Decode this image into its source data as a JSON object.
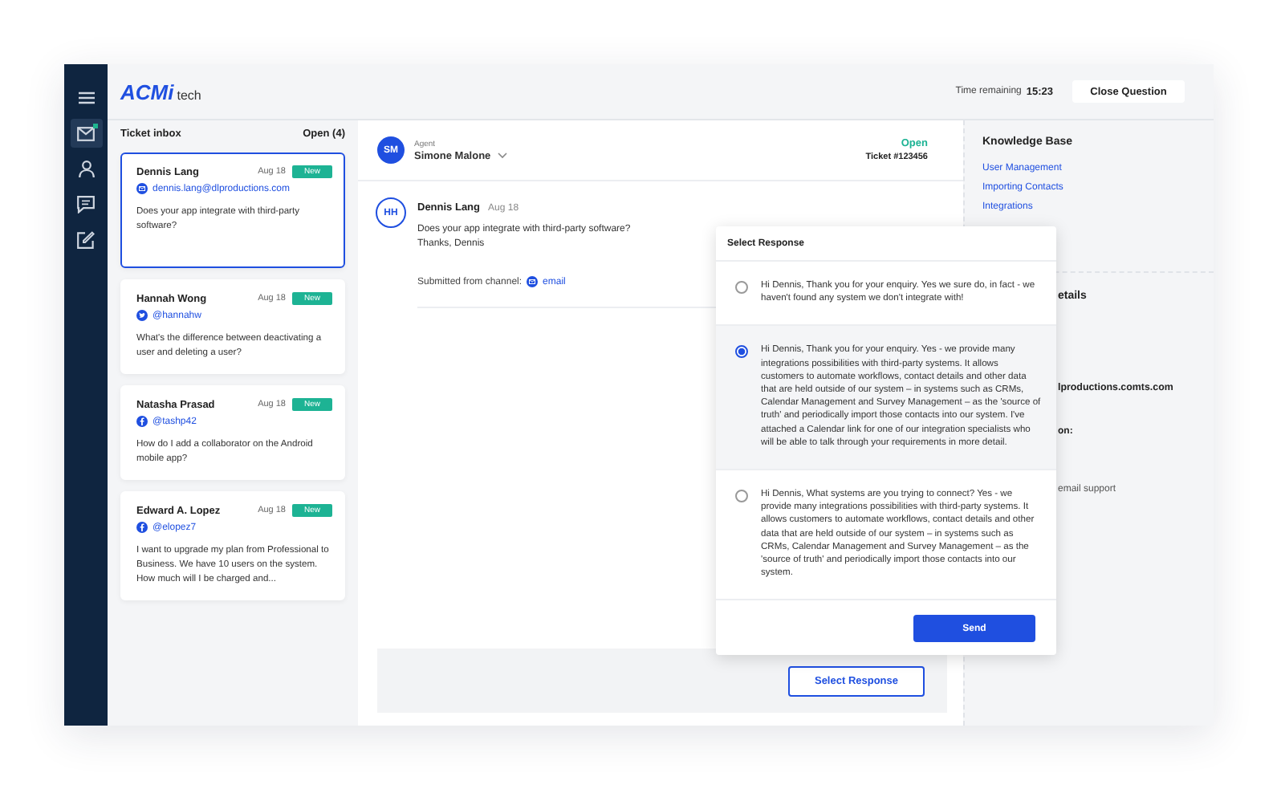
{
  "sidebar": {
    "items": [
      {
        "kind": "menu",
        "selected": false
      },
      {
        "kind": "mail",
        "selected": true,
        "notification": true
      },
      {
        "kind": "person",
        "selected": false
      },
      {
        "kind": "chat",
        "selected": false
      },
      {
        "kind": "edit",
        "selected": false
      }
    ]
  },
  "header": {
    "logo": {
      "main": "ACMi",
      "sub": "tech"
    },
    "time_label": "Time remaining",
    "time_value": "15:23",
    "close_button": "Close Question"
  },
  "inbox": {
    "title": "Ticket inbox",
    "count": "Open (4)",
    "tickets": [
      {
        "name": "Dennis Lang",
        "date": "Aug 18",
        "badge": "New",
        "kind": "email",
        "handle": "dennis.lang@dlproductions.com",
        "message": "Does your app integrate with third-party software?",
        "selected": true
      },
      {
        "name": "Hannah Wong",
        "date": "Aug 18",
        "badge": "New",
        "kind": "twitter",
        "handle": "@hannahw",
        "message": "What's the difference between deactivating a user and deleting a user?",
        "selected": false
      },
      {
        "name": "Natasha Prasad",
        "date": "Aug 18",
        "badge": "New",
        "kind": "facebook",
        "handle": "@tashp42",
        "message": "How do I add a collaborator on the Android mobile app?",
        "selected": false
      },
      {
        "name": "Edward A. Lopez",
        "date": "Aug 18",
        "badge": "New",
        "kind": "facebook",
        "handle": "@elopez7",
        "message": "I want to upgrade my plan from Professional to Business. We have 10 users on the system. How much will I be charged and...",
        "selected": false
      }
    ]
  },
  "ticket": {
    "agent_initials": "SM",
    "agent_label": "Agent",
    "agent_name": "Simone Malone",
    "status": "Open",
    "ticket_number": "Ticket #123456",
    "message": {
      "initials": "HH",
      "author": "Dennis Lang",
      "date": "Aug 18",
      "lines": [
        "Does your app integrate with third-party software?",
        "Thanks, Dennis"
      ],
      "channel_label": "Submitted from channel:",
      "channel": {
        "kind": "email",
        "label": "email"
      }
    },
    "select_button": "Select Response"
  },
  "knowledge_base": {
    "title": "Knowledge Base",
    "links": [
      "User Management",
      "Importing Contacts",
      "Integrations"
    ]
  },
  "details": {
    "heading_fragment": "etails",
    "email_fragment": "lproductions.comts.com",
    "label_fragment": "on:",
    "support_fragment": "email support"
  },
  "select_response": {
    "title": "Select Response",
    "options": [
      {
        "text": "Hi Dennis, Thank you for your enquiry. Yes we sure do, in fact - we haven't found any system we don't integrate with!",
        "selected": false
      },
      {
        "text": "Hi Dennis, Thank you for your enquiry. Yes - we provide many integrations possibilities with third-party systems. It allows customers to automate workflows, contact details and other data that are held outside of our system – in systems such as CRMs, Calendar Management and Survey Management – as the 'source of truth' and periodically import those contacts into our system. I've attached a Calendar link for one of our integration specialists who will be able to talk through your requirements in more detail.",
        "selected": true
      },
      {
        "text": "Hi Dennis, What systems are you trying to connect? Yes - we provide many integrations possibilities with third-party systems. It allows customers to automate workflows, contact details and other data that are held outside of our system – in systems such as CRMs, Calendar Management and Survey Management – as the 'source of truth' and periodically import those contacts into our system.",
        "selected": false
      }
    ],
    "send_button": "Send"
  }
}
